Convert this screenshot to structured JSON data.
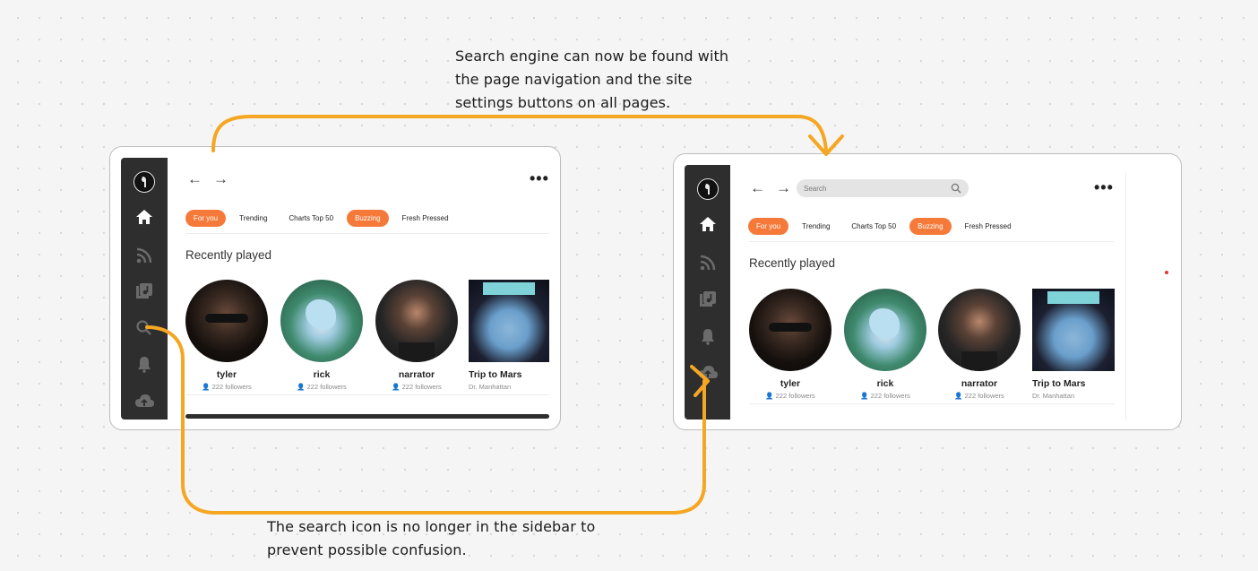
{
  "annotations": {
    "top_lines": [
      "Search engine can now be found with",
      "the page navigation and the site",
      "settings buttons on all pages."
    ],
    "bottom_lines": [
      "The search icon is no longer in the sidebar to",
      "prevent possible confusion."
    ]
  },
  "colors": {
    "accent": "#f57a3a",
    "arrow": "#f5a623",
    "sidebar": "#2e2e2e"
  },
  "before": {
    "nav": {
      "back": "←",
      "forward": "→",
      "more": "•••"
    },
    "sidebar_icons": [
      "avatar-icon",
      "home-icon",
      "rss-icon",
      "library-icon",
      "search-icon",
      "bell-icon",
      "cloud-upload-icon"
    ],
    "tabs": [
      "For you",
      "Trending",
      "Charts Top 50",
      "Buzzing",
      "Fresh Pressed"
    ],
    "section_title": "Recently played",
    "cards": [
      {
        "title": "tyler",
        "subtitle": "222 followers"
      },
      {
        "title": "rick",
        "subtitle": "222 followers"
      },
      {
        "title": "narrator",
        "subtitle": "222 followers"
      },
      {
        "title": "Trip to Mars",
        "subtitle": "Dr. Manhattan"
      }
    ]
  },
  "after": {
    "nav": {
      "back": "←",
      "forward": "→",
      "more": "•••"
    },
    "search": {
      "placeholder": "Search"
    },
    "sidebar_icons": [
      "avatar-icon",
      "home-icon",
      "rss-icon",
      "library-icon",
      "bell-icon",
      "cloud-upload-icon"
    ],
    "tabs": [
      "For you",
      "Trending",
      "Charts Top 50",
      "Buzzing",
      "Fresh Pressed"
    ],
    "section_title": "Recently played",
    "cards": [
      {
        "title": "tyler",
        "subtitle": "222 followers"
      },
      {
        "title": "rick",
        "subtitle": "222 followers"
      },
      {
        "title": "narrator",
        "subtitle": "222 followers"
      },
      {
        "title": "Trip to Mars",
        "subtitle": "Dr. Manhattan"
      }
    ]
  }
}
